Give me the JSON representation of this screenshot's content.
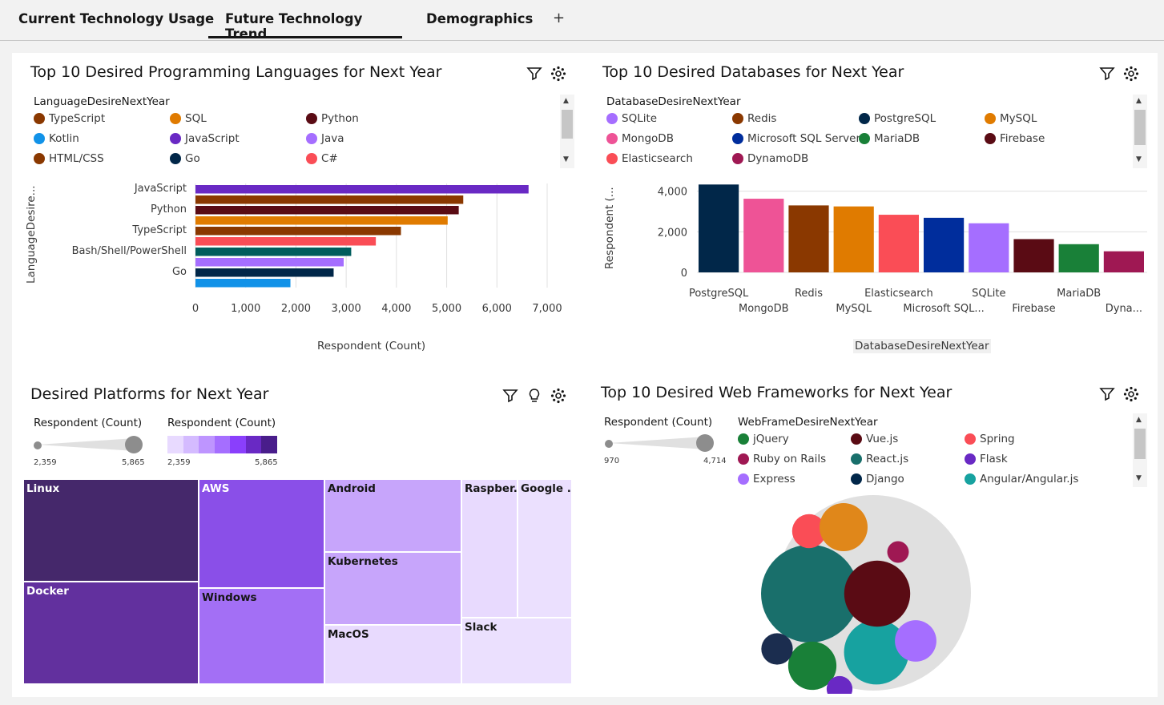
{
  "tabs": [
    {
      "label": "Current Technology Usage"
    },
    {
      "label": "Future Technology Trend"
    },
    {
      "label": "Demographics"
    }
  ],
  "add_tab": "+",
  "lang_panel": {
    "title": "Top 10 Desired Programming Languages for Next Year",
    "legend_title": "LanguageDesireNextYear",
    "legend": [
      {
        "name": "TypeScript",
        "color": "#8a3800"
      },
      {
        "name": "SQL",
        "color": "#e07b00"
      },
      {
        "name": "Python",
        "color": "#5a0b14"
      },
      {
        "name": "Kotlin",
        "color": "#1192e8"
      },
      {
        "name": "JavaScript",
        "color": "#6929c4"
      },
      {
        "name": "Java",
        "color": "#a56eff"
      },
      {
        "name": "HTML/CSS",
        "color": "#8a3800"
      },
      {
        "name": "Go",
        "color": "#012749"
      },
      {
        "name": "C#",
        "color": "#fa4d56"
      }
    ],
    "y_axis_label": "LanguageDesire...",
    "x_axis_label": "Respondent (Count)"
  },
  "db_panel": {
    "title": "Top 10 Desired Databases for Next Year",
    "legend_title": "DatabaseDesireNextYear",
    "legend": [
      {
        "name": "SQLite",
        "color": "#a56eff"
      },
      {
        "name": "Redis",
        "color": "#8a3800"
      },
      {
        "name": "PostgreSQL",
        "color": "#012749"
      },
      {
        "name": "MySQL",
        "color": "#e07b00"
      },
      {
        "name": "MongoDB",
        "color": "#ee5396"
      },
      {
        "name": "Microsoft SQL Server",
        "color": "#002d9c"
      },
      {
        "name": "MariaDB",
        "color": "#198038"
      },
      {
        "name": "Firebase",
        "color": "#5a0b14"
      },
      {
        "name": "Elasticsearch",
        "color": "#fa4d56"
      },
      {
        "name": "DynamoDB",
        "color": "#9f1853"
      }
    ],
    "y_axis_label": "Respondent (...",
    "x_axis_label": "DatabaseDesireNextYear"
  },
  "platform_panel": {
    "title": "Desired Platforms for Next Year",
    "size_legend_title": "Respondent (Count)",
    "color_legend_title": "Respondent (Count)",
    "size_min": "2,359",
    "size_max": "5,865",
    "color_min": "2,359",
    "color_max": "5,865",
    "tiles": [
      "Linux",
      "AWS",
      "Android",
      "Raspber...",
      "Google ...",
      "Docker",
      "Windows",
      "Kubernetes",
      "MacOS",
      "Slack"
    ]
  },
  "web_panel": {
    "title": "Top 10 Desired Web Frameworks for Next Year",
    "size_legend_title": "Respondent (Count)",
    "size_min": "970",
    "size_max": "4,714",
    "legend_title": "WebFrameDesireNextYear",
    "legend": [
      {
        "name": "jQuery",
        "color": "#198038"
      },
      {
        "name": "Vue.js",
        "color": "#5a0b14"
      },
      {
        "name": "Spring",
        "color": "#fa4d56"
      },
      {
        "name": "Ruby on Rails",
        "color": "#9f1853"
      },
      {
        "name": "React.js",
        "color": "#196f6b"
      },
      {
        "name": "Flask",
        "color": "#6929c4"
      },
      {
        "name": "Express",
        "color": "#a56eff"
      },
      {
        "name": "Django",
        "color": "#012749"
      },
      {
        "name": "Angular/Angular.js",
        "color": "#17a2a0"
      }
    ]
  },
  "chart_data": [
    {
      "type": "bar",
      "orientation": "horizontal",
      "title": "Top 10 Desired Programming Languages for Next Year",
      "xlabel": "Respondent (Count)",
      "ylabel": "LanguageDesire...",
      "xlim": [
        0,
        7000
      ],
      "xticks": [
        "0",
        "1,000",
        "2,000",
        "3,000",
        "4,000",
        "5,000",
        "6,000",
        "7,000"
      ],
      "y_tick_labels": [
        "JavaScript",
        "Python",
        "TypeScript",
        "Bash/Shell/PowerShell",
        "Go"
      ],
      "categories": [
        "JavaScript",
        "HTML/CSS",
        "Python",
        "SQL",
        "TypeScript",
        "C#",
        "Bash/Shell/PowerShell",
        "Java",
        "Go",
        "Kotlin"
      ],
      "colors": [
        "#6929c4",
        "#8a3800",
        "#5a0b14",
        "#e07b00",
        "#8a3800",
        "#fa4d56",
        "#005d5d",
        "#a56eff",
        "#012749",
        "#1192e8"
      ],
      "values": [
        6630,
        5330,
        5240,
        5020,
        4090,
        3590,
        3100,
        2950,
        2750,
        1890
      ]
    },
    {
      "type": "bar",
      "title": "Top 10 Desired Databases for Next Year",
      "xlabel": "DatabaseDesireNextYear",
      "ylabel": "Respondent (...",
      "ylim": [
        0,
        4500
      ],
      "yticks": [
        "0",
        "2,000",
        "4,000"
      ],
      "categories": [
        "PostgreSQL",
        "MongoDB",
        "Redis",
        "MySQL",
        "Elasticsearch",
        "Microsoft SQL...",
        "SQLite",
        "Firebase",
        "MariaDB",
        "Dyna..."
      ],
      "colors": [
        "#012749",
        "#ee5396",
        "#8a3800",
        "#e07b00",
        "#fa4d56",
        "#002d9c",
        "#a56eff",
        "#5a0b14",
        "#198038",
        "#9f1853"
      ],
      "values": [
        4330,
        3630,
        3300,
        3250,
        2840,
        2690,
        2420,
        1640,
        1390,
        1040
      ]
    },
    {
      "type": "treemap",
      "title": "Desired Platforms for Next Year",
      "categories": [
        "Linux",
        "Docker",
        "AWS",
        "Windows",
        "Android",
        "Kubernetes",
        "MacOS",
        "Raspber...",
        "Google ...",
        "Slack"
      ],
      "values": [
        5865,
        5250,
        4600,
        4450,
        3500,
        3500,
        2950,
        2500,
        2359,
        2359
      ]
    },
    {
      "type": "bubble",
      "title": "Top 10 Desired Web Frameworks for Next Year",
      "categories": [
        "React.js",
        "Angular/Angular.js",
        "Vue.js",
        "jQuery",
        "Express",
        "Spring",
        "Django",
        "Flask",
        "Ruby on Rails"
      ],
      "values": [
        4714,
        2070,
        2150,
        1150,
        850,
        570,
        490,
        330,
        230
      ]
    }
  ]
}
